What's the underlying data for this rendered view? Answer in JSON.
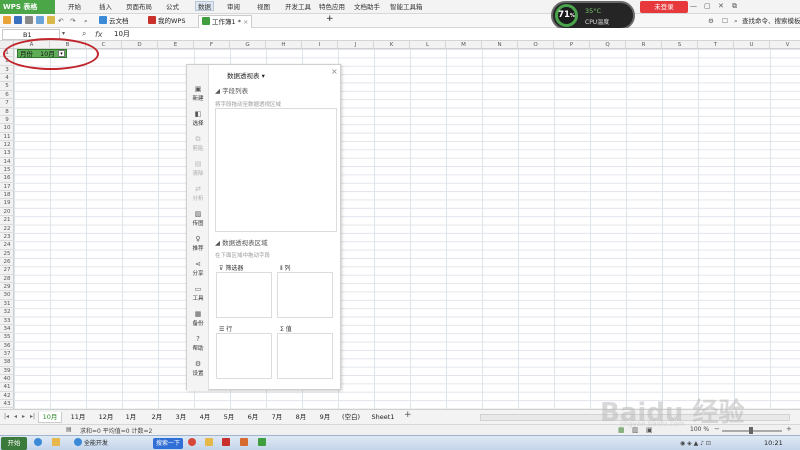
{
  "app": {
    "brand": "WPS 表格",
    "brand_color": "#4aa647"
  },
  "menu": [
    "开始",
    "插入",
    "页面布局",
    "公式",
    "数据",
    "审阅",
    "视图",
    "开发工具",
    "特色应用",
    "文档助手",
    "智能工具箱"
  ],
  "menu_active": "数据",
  "login_label": "未登录",
  "search_hint": "查找命令、搜索模板",
  "cpu": {
    "usage": "71",
    "unit": "%",
    "temp": "35°C",
    "label": "CPU温度"
  },
  "doc_tabs": [
    {
      "label": "云文档",
      "icon": "cloud-icon"
    },
    {
      "label": "我的WPS",
      "icon": "wps-home-icon"
    },
    {
      "label": "工作簿1 *",
      "icon": "sheet-doc-icon",
      "active": true
    }
  ],
  "formula_bar": {
    "cell_ref": "B1",
    "fx": "fx",
    "value": "10月"
  },
  "columns": [
    "A",
    "B",
    "C",
    "D",
    "E",
    "F",
    "G",
    "H",
    "I",
    "J",
    "K",
    "L",
    "M",
    "N",
    "O",
    "P",
    "Q",
    "R",
    "S",
    "T",
    "U",
    "V"
  ],
  "rows": [
    "1",
    "2",
    "3",
    "4",
    "5",
    "6",
    "7",
    "8",
    "9",
    "10",
    "11",
    "12",
    "13",
    "14",
    "15",
    "16",
    "17",
    "18",
    "19",
    "20",
    "21",
    "22",
    "23",
    "24",
    "25",
    "26",
    "27",
    "28",
    "29",
    "30",
    "31",
    "32",
    "33",
    "34",
    "35",
    "36",
    "37",
    "38",
    "39",
    "40",
    "41",
    "42",
    "43"
  ],
  "cells": {
    "a1": "月份",
    "b1": "10月"
  },
  "pivot": {
    "title": "数据透视表",
    "field_section": "字段列表",
    "field_hint": "将字段拖动至数据透视区域",
    "areas_section": "数据透视表区域",
    "areas_hint": "在下面区域中拖动字段",
    "areas": {
      "filter": "筛选器",
      "column": "列",
      "row": "行",
      "value": "值"
    },
    "nav": [
      {
        "label": "新建",
        "icon": "new-icon",
        "disabled": false
      },
      {
        "label": "选择",
        "icon": "select-icon",
        "disabled": false
      },
      {
        "label": "剪贴",
        "icon": "clipboard-icon",
        "disabled": true
      },
      {
        "label": "清除",
        "icon": "eraser-icon",
        "disabled": true
      },
      {
        "label": "分析",
        "icon": "analysis-icon",
        "disabled": true
      },
      {
        "label": "传图",
        "icon": "image-icon",
        "disabled": false
      },
      {
        "label": "推荐",
        "icon": "bulb-icon",
        "disabled": false
      },
      {
        "label": "分享",
        "icon": "share-icon",
        "disabled": false
      },
      {
        "label": "工具",
        "icon": "toolbox-icon",
        "disabled": false
      },
      {
        "label": "备份",
        "icon": "backup-icon",
        "disabled": false
      },
      {
        "label": "帮助",
        "icon": "help-icon",
        "disabled": false
      },
      {
        "label": "设置",
        "icon": "settings-icon",
        "disabled": false
      }
    ]
  },
  "sheets": [
    "10月",
    "11月",
    "12月",
    "1月",
    "2月",
    "3月",
    "4月",
    "5月",
    "6月",
    "7月",
    "8月",
    "9月",
    "(空白)",
    "Sheet1"
  ],
  "sheet_active": "10月",
  "status": {
    "summary": "求和=0   平均值=0   计数=2",
    "zoom": "100 %"
  },
  "taskbar": {
    "start": "开始",
    "apps": [
      "全能开发",
      "搜索一下"
    ],
    "clock": "10:21"
  },
  "watermark": {
    "text": "Baidu 经验",
    "sub": "jingyan.baidu.com"
  }
}
